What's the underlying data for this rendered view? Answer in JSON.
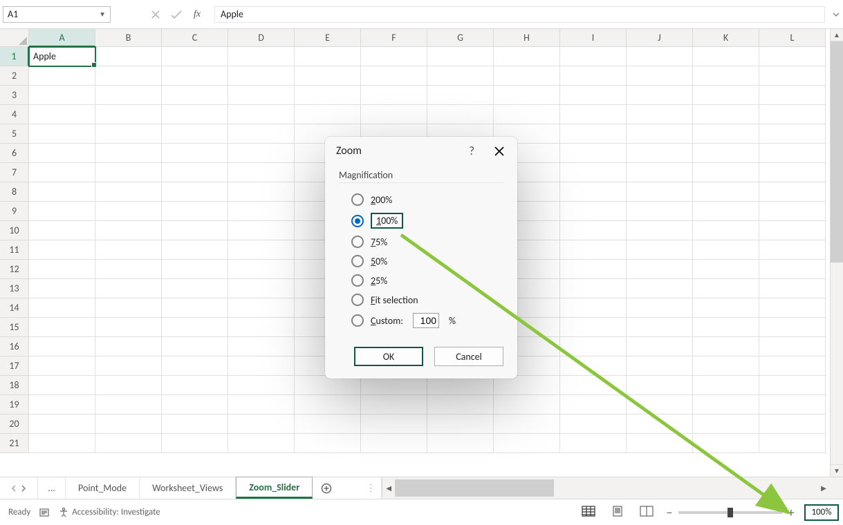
{
  "namebox": {
    "value": "A1"
  },
  "formula": {
    "value": "Apple"
  },
  "columns": [
    "A",
    "B",
    "C",
    "D",
    "E",
    "F",
    "G",
    "H",
    "I",
    "J",
    "K",
    "L"
  ],
  "rows": [
    "1",
    "2",
    "3",
    "4",
    "5",
    "6",
    "7",
    "8",
    "9",
    "10",
    "11",
    "12",
    "13",
    "14",
    "15",
    "16",
    "17",
    "18",
    "19",
    "20",
    "21"
  ],
  "cell_a1": "Apple",
  "dialog": {
    "title": "Zoom",
    "group": "Magnification",
    "options": {
      "o200": "00%",
      "o200p": "2",
      "o100": "00%",
      "o100p": "1",
      "o75": "5%",
      "o75p": "7",
      "o50": "0%",
      "o50p": "5",
      "o25": "5%",
      "o25p": "2",
      "fit": "it selection",
      "fitp": "F",
      "custom_label": "ustom:",
      "custom_p": "C",
      "custom_value": "100",
      "custom_suffix": "%"
    },
    "ok": "OK",
    "cancel": "Cancel"
  },
  "tabs": {
    "ellipsis": "...",
    "t1": "Point_Mode",
    "t2": "Worksheet_Views",
    "t3": "Zoom_Slider"
  },
  "status": {
    "ready": "Ready",
    "acc": "Accessibility: Investigate",
    "zoom": "100%"
  }
}
